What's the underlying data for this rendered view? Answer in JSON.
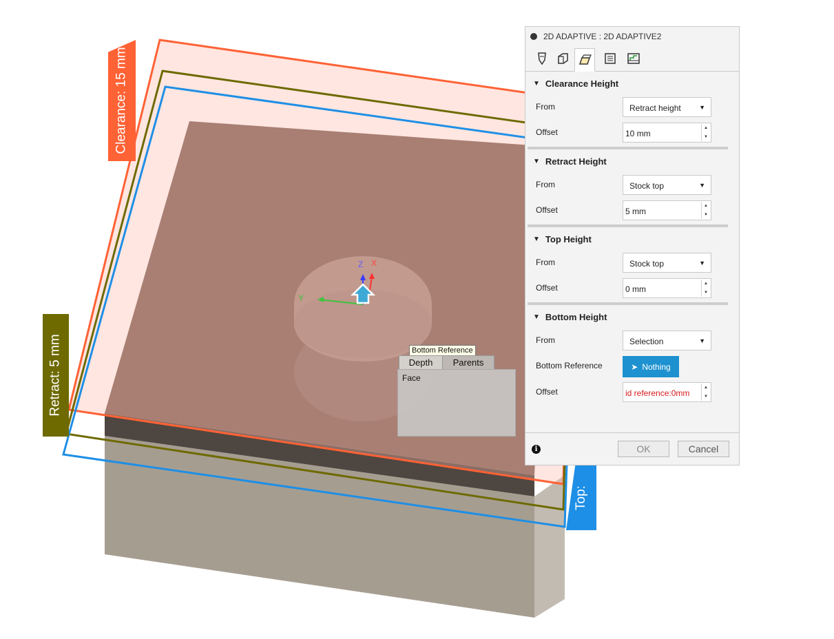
{
  "viewport": {
    "labels": {
      "clearance": "Clearance: 15 mm",
      "retract": "Retract: 5 mm",
      "top": "Top:"
    },
    "triad": {
      "z": "Z",
      "x": "X",
      "y": "Y"
    },
    "colors": {
      "clearance": "#ff6235",
      "retract": "#6e6a00",
      "top": "#1e8fe6",
      "stock_top": "#7b6156",
      "stock_side": "#a69d91"
    }
  },
  "selection_popup": {
    "tooltip": "Bottom Reference",
    "tabs": [
      "Depth",
      "Parents"
    ],
    "items": [
      "Face"
    ]
  },
  "dialog": {
    "title": "2D ADAPTIVE : 2D ADAPTIVE2",
    "tab_icons": [
      "tool-icon",
      "geometry-icon",
      "heights-icon",
      "passes-icon",
      "linking-icon"
    ],
    "sections": {
      "clearance": {
        "title": "Clearance Height",
        "from_label": "From",
        "from_value": "Retract height",
        "offset_label": "Offset",
        "offset_value": "10 mm"
      },
      "retract": {
        "title": "Retract Height",
        "from_label": "From",
        "from_value": "Stock top",
        "offset_label": "Offset",
        "offset_value": "5 mm"
      },
      "top": {
        "title": "Top Height",
        "from_label": "From",
        "from_value": "Stock top",
        "offset_label": "Offset",
        "offset_value": "0 mm"
      },
      "bottom": {
        "title": "Bottom Height",
        "from_label": "From",
        "from_value": "Selection",
        "reference_label": "Bottom Reference",
        "reference_value": "Nothing",
        "offset_label": "Offset",
        "offset_value": "id reference:0mm"
      }
    },
    "ok_label": "OK",
    "cancel_label": "Cancel"
  }
}
